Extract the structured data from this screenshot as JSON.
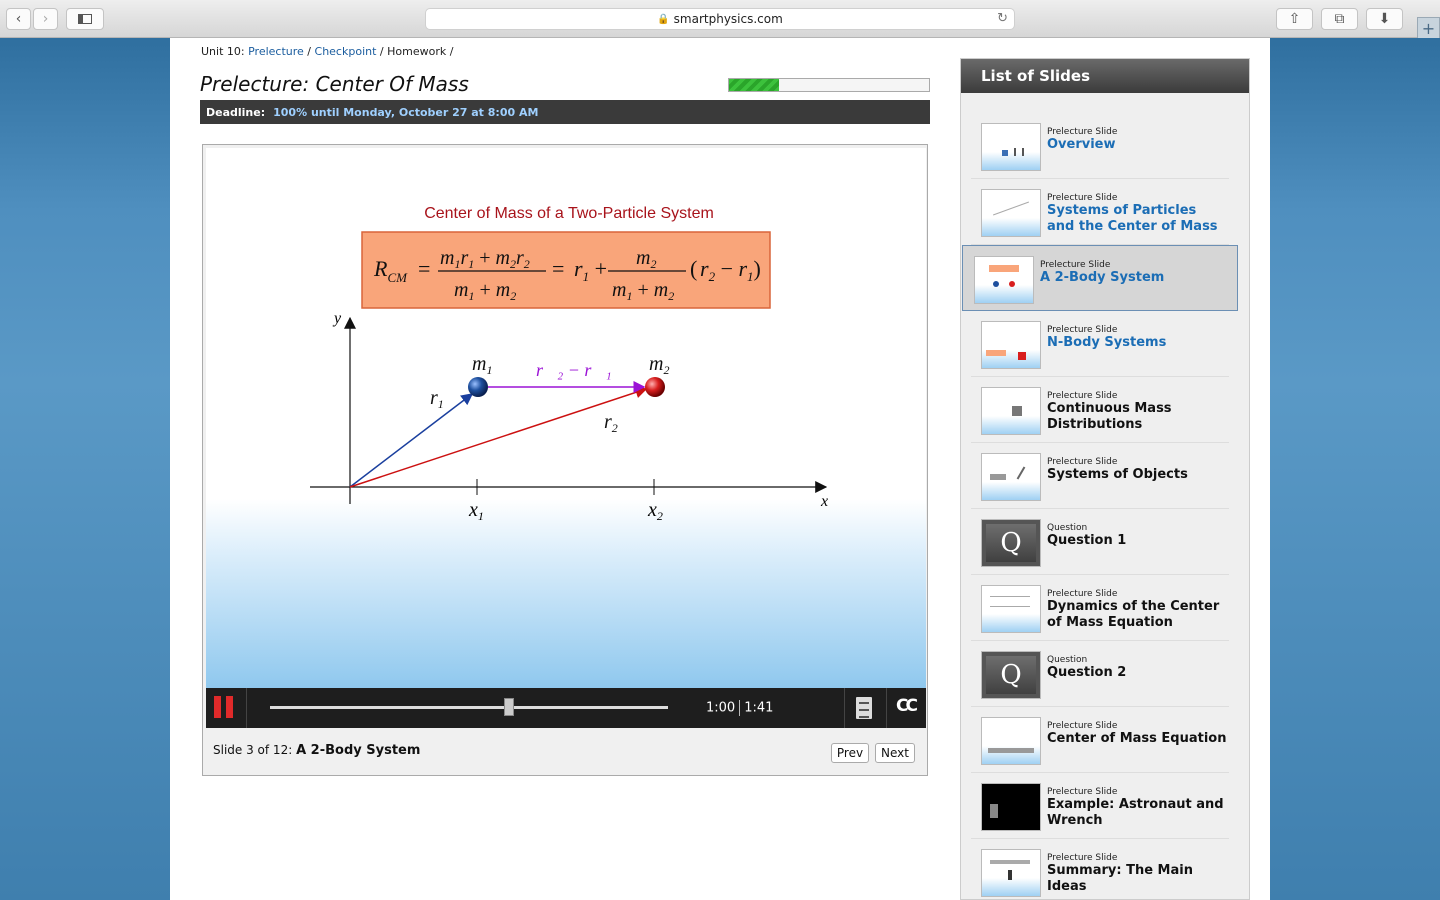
{
  "browser": {
    "url": "smartphysics.com"
  },
  "breadcrumb": {
    "unit": "Unit 10:",
    "prelecture": "Prelecture",
    "checkpoint": "Checkpoint",
    "homework": "Homework",
    "sep": "/"
  },
  "page_title": "Prelecture: Center Of Mass",
  "progress_fraction": 0.25,
  "deadline": {
    "label": "Deadline:",
    "value": "100% until Monday, October 27 at 8:00 AM"
  },
  "slide": {
    "heading": "Center of Mass of a Two-Particle System",
    "labels": {
      "y": "y",
      "x": "x",
      "m1": "m",
      "m1_sub": "1",
      "m2": "m",
      "m2_sub": "2",
      "r1": "r",
      "r1_sub": "1",
      "r2": "r",
      "r2_sub": "2",
      "x1": "x",
      "x1_sub": "1",
      "x2": "x",
      "x2_sub": "2",
      "diff": "r⃗₂ − r⃗₁"
    },
    "formula_color": "#f9a57a"
  },
  "player": {
    "current_time": "1:00",
    "total_time": "1:41",
    "position_fraction": 0.6
  },
  "slide_info": {
    "prefix": "Slide 3 of 12:",
    "name": "A 2-Body System"
  },
  "nav": {
    "prev": "Prev",
    "next": "Next"
  },
  "sidebar": {
    "header": "List of Slides",
    "items": [
      {
        "kind": "Prelecture Slide",
        "title": "Overview",
        "link": true
      },
      {
        "kind": "Prelecture Slide",
        "title": "Systems of Particles and the Center of Mass",
        "link": true
      },
      {
        "kind": "Prelecture Slide",
        "title": "A 2-Body System",
        "link": true,
        "active": true
      },
      {
        "kind": "Prelecture Slide",
        "title": "N-Body Systems",
        "link": true
      },
      {
        "kind": "Prelecture Slide",
        "title": "Continuous Mass Distributions",
        "link": false
      },
      {
        "kind": "Prelecture Slide",
        "title": "Systems of Objects",
        "link": false
      },
      {
        "kind": "Question",
        "title": "Question 1",
        "link": false
      },
      {
        "kind": "Prelecture Slide",
        "title": "Dynamics of the Center of Mass Equation",
        "link": false
      },
      {
        "kind": "Question",
        "title": "Question 2",
        "link": false
      },
      {
        "kind": "Prelecture Slide",
        "title": "Center of Mass Equation",
        "link": false
      },
      {
        "kind": "Prelecture Slide",
        "title": "Example: Astronaut and Wrench",
        "link": false
      },
      {
        "kind": "Prelecture Slide",
        "title": "Summary: The Main Ideas",
        "link": false
      }
    ]
  }
}
